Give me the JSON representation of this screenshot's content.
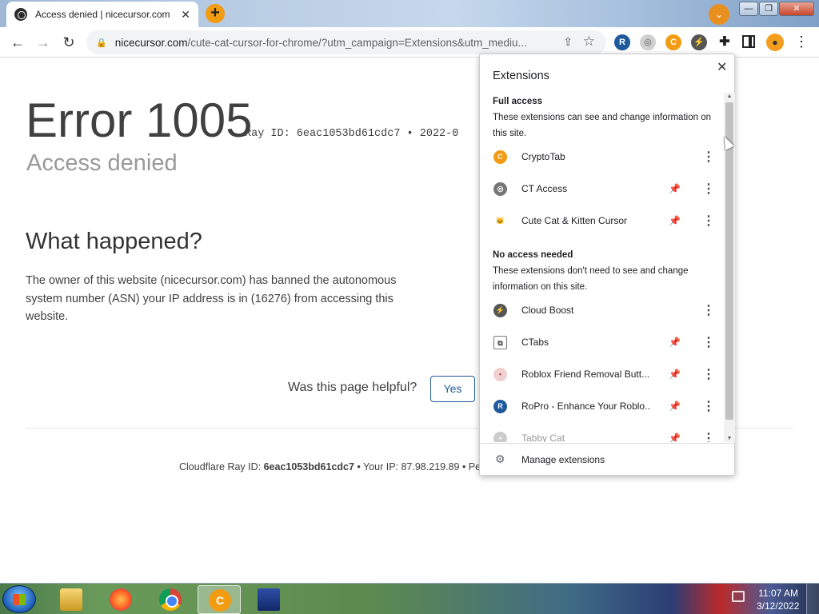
{
  "browser": {
    "tab": {
      "title": "Access denied | nicecursor.com",
      "close": "✕"
    },
    "new_tab": "+",
    "tab_search": "⌄",
    "window_controls": {
      "minimize": "—",
      "maximize": "❐",
      "close": "✕"
    },
    "nav": {
      "back": "←",
      "forward": "→",
      "reload": "↻"
    },
    "omnibox": {
      "host": "nicecursor.com",
      "path": "/cute-cat-cursor-for-chrome/?utm_campaign=Extensions&utm_mediu..."
    },
    "toolbar_icons": {
      "ropro": "R",
      "ct_access": "◎",
      "cryptotab": "C",
      "cloud_boost": "⚡",
      "extensions": "✚",
      "menu": "⋮"
    }
  },
  "page": {
    "error_code": "Error 1005",
    "ray_line": "Ray ID: 6eac1053bd61cdc7 • 2022-0",
    "subtitle": "Access denied",
    "what_heading": "What happened?",
    "what_text": "The owner of this website (nicecursor.com) has banned the autonomous system number (ASN) your IP address is in (16276) from accessing this website.",
    "helpful_question": "Was this page helpful?",
    "yes_label": "Yes",
    "footer": {
      "ray_label": "Cloudflare Ray ID:",
      "ray_id": "6eac1053bd61cdc7",
      "ip_text": "• Your IP: 87.98.219.89 • Pe"
    }
  },
  "extensions_popup": {
    "title": "Extensions",
    "close": "✕",
    "full_access": {
      "heading": "Full access",
      "description": "These extensions can see and change information on this site.",
      "items": [
        {
          "name": "CryptoTab",
          "icon": "C",
          "icon_color": "#f39c12",
          "pinned": null
        },
        {
          "name": "CT Access",
          "icon": "◎",
          "icon_color": "#777777",
          "pinned": false
        },
        {
          "name": "Cute Cat & Kitten Cursor",
          "icon": "🐱",
          "icon_color": "#ffffff",
          "pinned": false
        }
      ]
    },
    "no_access": {
      "heading": "No access needed",
      "description": "These extensions don't need to see and change information on this site.",
      "items": [
        {
          "name": "Cloud Boost",
          "icon": "⚡",
          "icon_color": "#555555",
          "pinned": null
        },
        {
          "name": "CTabs",
          "icon": "⧉",
          "icon_color": "#ffffff",
          "pinned": false
        },
        {
          "name": "Roblox Friend Removal Butt...",
          "icon": "•",
          "icon_color": "#f0d0d0",
          "pinned": false
        },
        {
          "name": "RoPro - Enhance Your Roblo...",
          "icon": "R",
          "icon_color": "#1e5a9b",
          "pinned": true
        },
        {
          "name": "Tabby Cat",
          "icon": "•",
          "icon_color": "#cccccc",
          "pinned": true
        }
      ]
    },
    "manage_label": "Manage extensions"
  },
  "taskbar": {
    "clock_time": "11:07 AM",
    "clock_date": "3/12/2022",
    "apps": [
      "windows-explorer",
      "firefox",
      "chrome",
      "cryptotab-browser",
      "network-app"
    ]
  }
}
